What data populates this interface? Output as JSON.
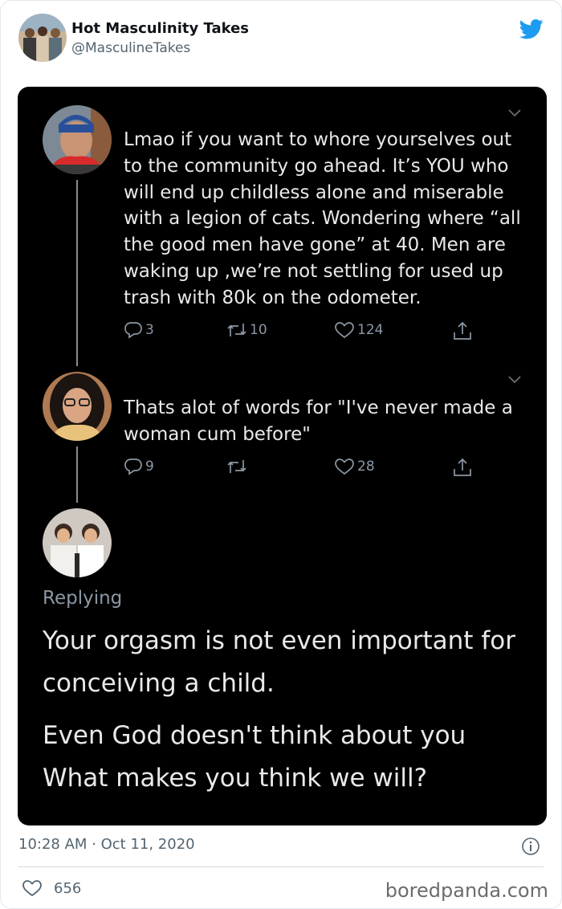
{
  "tweet": {
    "author_name": "Hot Masculinity Takes",
    "author_handle": "@MasculineTakes",
    "timestamp": "10:28 AM · Oct 11, 2020",
    "likes": "656"
  },
  "screenshot": {
    "replies": [
      {
        "text": "Lmao if you want to whore yourselves out\nto the community go ahead. It’s YOU who\nwill end up childless alone and miserable\nwith a legion of cats. Wondering where “all\nthe good men have gone” at 40. Men are\nwaking up ,we’re not settling for used up\ntrash with 80k on the odometer.",
        "reply_count": "3",
        "retweet_count": "10",
        "like_count": "124"
      },
      {
        "text": "Thats alot of words for \"I've never made a\nwoman cum before\"",
        "reply_count": "9",
        "retweet_count": "",
        "like_count": "28"
      }
    ],
    "composer": {
      "label": "Replying",
      "line1": "Your orgasm is not even important for\nconceiving a child.",
      "line2": "Even God doesn't think about you\nWhat makes you think we will?"
    }
  },
  "watermark": "boredpanda.com",
  "colors": {
    "twitter_blue": "#1d9bf0",
    "dark_bg": "#000000",
    "muted": "#536471"
  },
  "icons": [
    "twitter-bird-icon",
    "reply-icon",
    "retweet-icon",
    "heart-icon",
    "share-icon",
    "chevron-down-icon",
    "info-icon"
  ]
}
